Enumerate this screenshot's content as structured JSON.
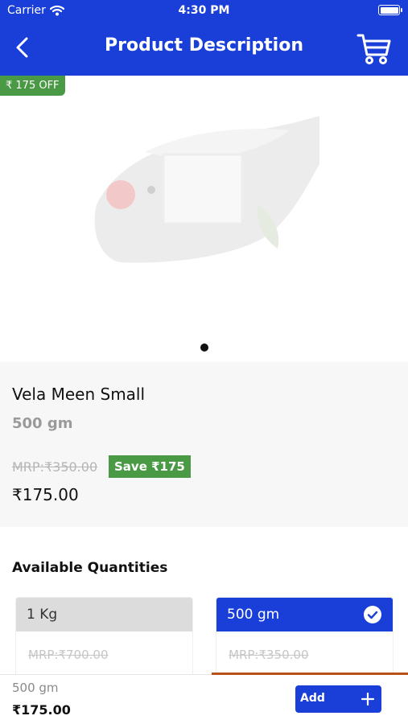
{
  "status_bar": {
    "carrier": "Carrier",
    "time": "4:30 PM"
  },
  "header": {
    "title": "Product Description"
  },
  "product": {
    "discount_badge": "₹ 175 OFF",
    "name": "Vela Meen Small",
    "weight": "500 gm",
    "mrp": "MRP:₹350.00",
    "save_badge": "Save ₹175",
    "price": "₹175.00",
    "image_carousel": {
      "total": 1,
      "current": 1
    }
  },
  "quantities": {
    "title": "Available Quantities",
    "options": [
      {
        "label": "1 Kg",
        "mrp": "MRP:₹700.00",
        "selected": false
      },
      {
        "label": "500 gm",
        "mrp": "MRP:₹350.00",
        "selected": true
      }
    ]
  },
  "bottom_bar": {
    "weight": "500 gm",
    "price": "₹175.00",
    "add_label": "Add"
  },
  "colors": {
    "brand_blue": "#1a3ed8",
    "save_green": "#4a9a45",
    "accent_orange": "#b8521a"
  }
}
